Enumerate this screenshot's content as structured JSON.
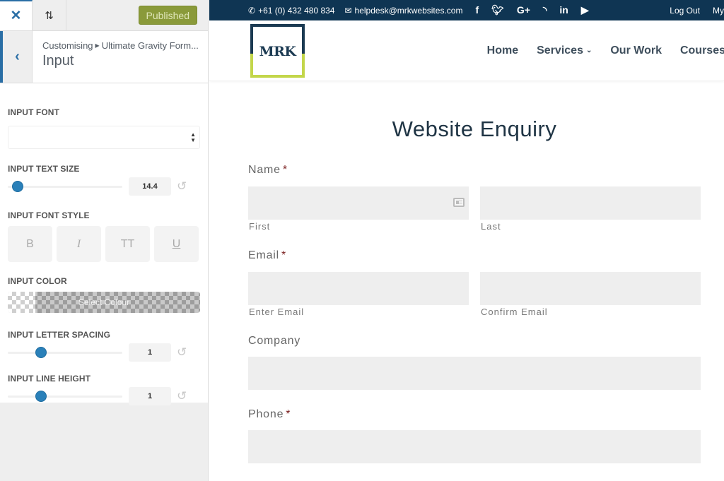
{
  "customizer": {
    "close_icon": "close-icon",
    "sort_icon": "reorder-arrows-icon",
    "publish_label": "Published",
    "back_icon": "chevron-left-icon",
    "breadcrumb": [
      "Customising",
      "Ultimate Gravity Form..."
    ],
    "section_title": "Input",
    "controls": {
      "font": {
        "label": "INPUT FONT",
        "value": ""
      },
      "text_size": {
        "label": "INPUT TEXT SIZE",
        "value": "14.4",
        "slider_fraction": 0.04
      },
      "font_style": {
        "label": "INPUT FONT STYLE",
        "buttons": [
          "B",
          "I",
          "TT",
          "U"
        ]
      },
      "color": {
        "label": "INPUT COLOR",
        "button_label": "Select Colour"
      },
      "letter_spacing": {
        "label": "INPUT LETTER SPACING",
        "value": "1",
        "slider_fraction": 0.27
      },
      "line_height": {
        "label": "INPUT LINE HEIGHT",
        "value": "1",
        "slider_fraction": 0.27
      }
    }
  },
  "site": {
    "topbar": {
      "phone": "+61 (0) 432 480 834",
      "email": "helpdesk@mrkwebsites.com",
      "social": [
        "facebook",
        "twitter",
        "google-plus",
        "rss",
        "linkedin",
        "youtube"
      ],
      "social_glyphs": [
        "f",
        "🐦",
        "G+",
        "◝",
        "in",
        "▶"
      ],
      "links": [
        "Log Out",
        "My"
      ]
    },
    "logo_text": "MRK",
    "brand_colors": {
      "navy": "#0f3553",
      "lime": "#c3d64a"
    },
    "nav": [
      "Home",
      "Services",
      "Our Work",
      "Courses"
    ],
    "form": {
      "title": "Website Enquiry",
      "fields": {
        "name": {
          "label": "Name",
          "required": "*",
          "sub": [
            "First",
            "Last"
          ]
        },
        "email": {
          "label": "Email",
          "required": "*",
          "sub": [
            "Enter Email",
            "Confirm Email"
          ]
        },
        "company": {
          "label": "Company"
        },
        "phone": {
          "label": "Phone",
          "required": "*"
        }
      }
    }
  }
}
